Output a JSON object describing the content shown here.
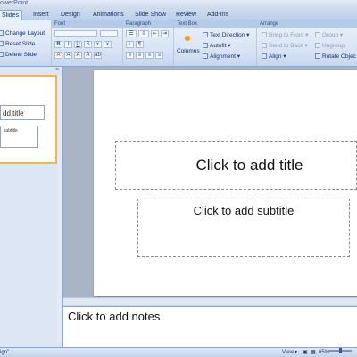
{
  "app": {
    "title_fragment": "owerPoint"
  },
  "tabs": [
    {
      "label": "Slides",
      "active": true
    },
    {
      "label": "Insert"
    },
    {
      "label": "Design"
    },
    {
      "label": "Animations"
    },
    {
      "label": "Slide Show"
    },
    {
      "label": "Review"
    },
    {
      "label": "Add-Ins"
    }
  ],
  "ribbon": {
    "slides": {
      "change_layout": "Change Layout",
      "reset_slide": "Reset Slide",
      "delete_slide": "Delete Slide"
    },
    "font": {
      "header": "Font"
    },
    "paragraph": {
      "header": "Paragraph"
    },
    "textbox": {
      "header": "Text Box",
      "columns": "Columns"
    },
    "text_options": {
      "text_direction": "Text Direction",
      "autofit": "Autofit",
      "alignment": "Alignment"
    },
    "arrange": {
      "header": "Arrange",
      "bring_to_front": "Bring to Front",
      "send_to_back": "Send to Back",
      "align": "Align",
      "group": "Group",
      "ungroup": "Ungroup",
      "rotate": "Rotate Objec"
    }
  },
  "left_pane": {
    "close_glyph": "×",
    "thumb_title": "dd title",
    "thumb_subtitle": "subtitle"
  },
  "slide": {
    "title_placeholder": "Click to add title",
    "subtitle_placeholder": "Click to add subtitle"
  },
  "notes": {
    "placeholder": "Click to add notes"
  },
  "status": {
    "left": "ign\"",
    "view": "View",
    "zoom": "65%"
  },
  "colors": {
    "selection": "#f0b74c",
    "ribbon_header": "#b6c9e6",
    "workspace": "#a9b4c4"
  }
}
